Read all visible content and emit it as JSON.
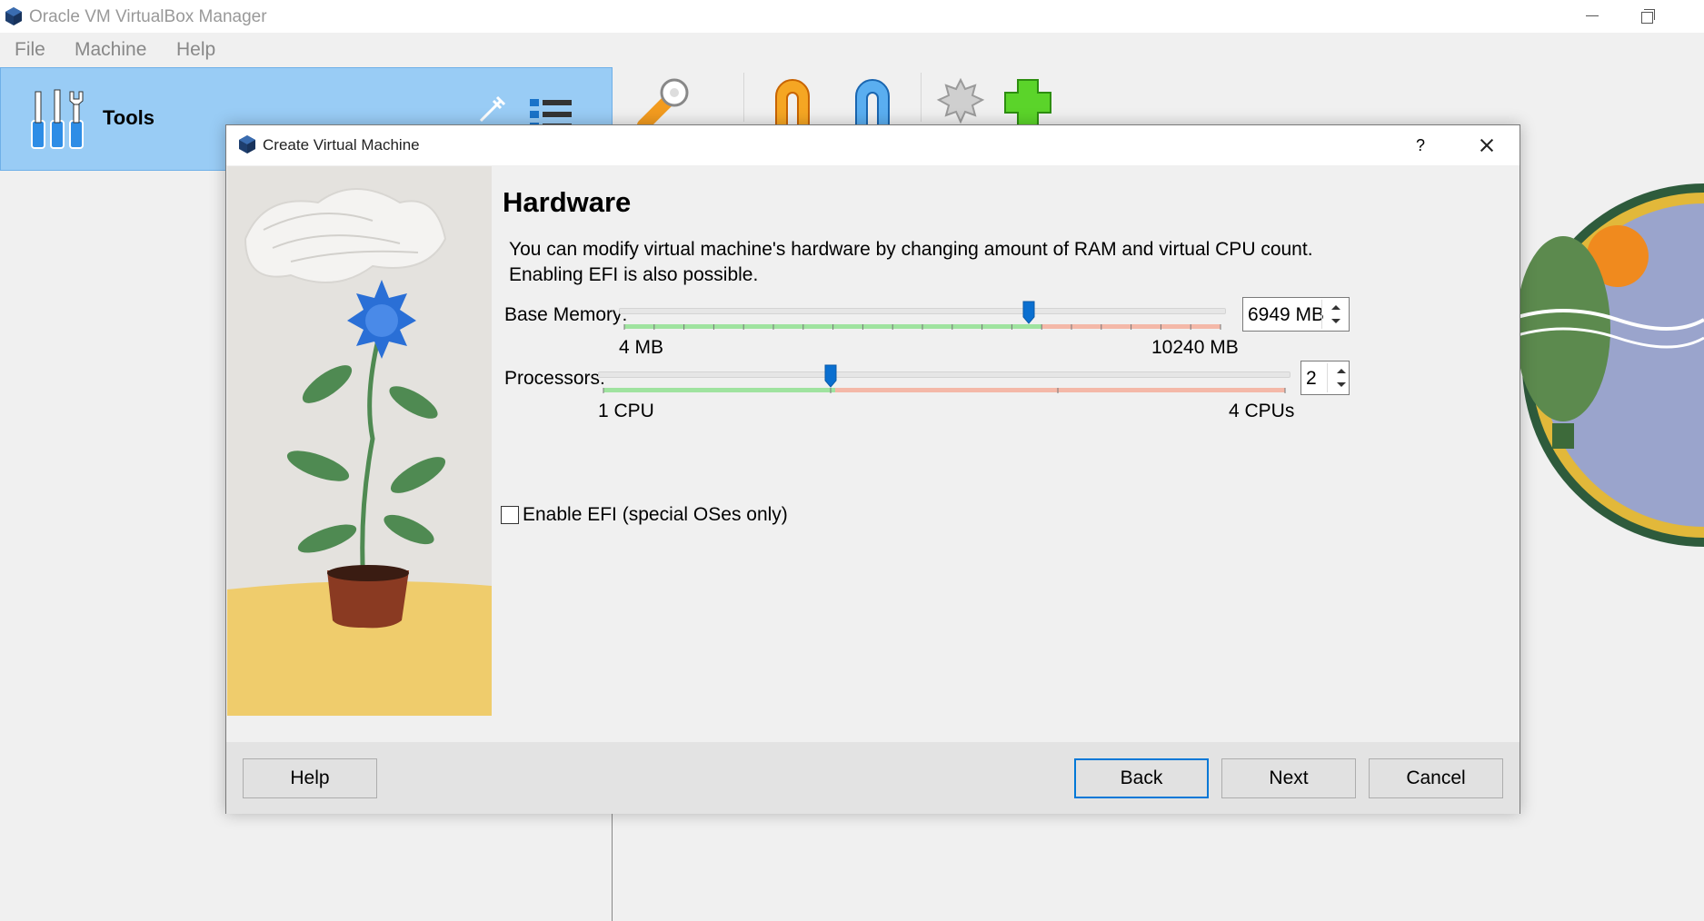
{
  "app": {
    "title": "Oracle VM VirtualBox Manager"
  },
  "menu": [
    "File",
    "Machine",
    "Help"
  ],
  "tools": {
    "label": "Tools"
  },
  "toolbar": {
    "icons": [
      "preferences-icon",
      "import-icon",
      "export-icon",
      "extensions-icon",
      "add-vm-icon"
    ]
  },
  "dialog": {
    "title": "Create Virtual Machine",
    "help_glyph": "?",
    "heading": "Hardware",
    "description_line1": "You can modify virtual machine's hardware by changing amount of RAM and virtual CPU count.",
    "description_line2": "Enabling EFI is also possible.",
    "base_memory": {
      "label": "Base Memory:",
      "min_label": "4 MB",
      "max_label": "10240 MB",
      "value": "6949 MB",
      "value_number": 6949,
      "min": 4,
      "max": 10240
    },
    "processors": {
      "label": "Processors:",
      "min_label": "1 CPU",
      "max_label": "4 CPUs",
      "value": "2",
      "value_number": 2,
      "min": 1,
      "max": 4
    },
    "efi": {
      "label": "Enable EFI (special OSes only)",
      "checked": false
    },
    "buttons": {
      "help": "Help",
      "back": "Back",
      "next": "Next",
      "cancel": "Cancel"
    }
  },
  "colors": {
    "accent": "#0078d7",
    "tools_bg": "#99ccf5",
    "slider_ok": "#9fe39f",
    "slider_warn": "#f4b8a8"
  }
}
